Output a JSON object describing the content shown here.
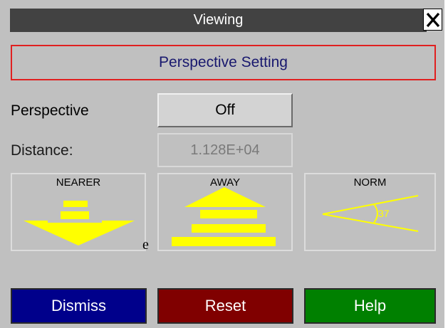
{
  "window": {
    "title": "Viewing",
    "close_glyph": "X"
  },
  "section": {
    "title": "Perspective Setting"
  },
  "perspective": {
    "label": "Perspective",
    "button": "Off"
  },
  "distance": {
    "label": "Distance:",
    "value": "1.128E+04"
  },
  "icons": [
    {
      "label": "NEARER",
      "icon": "arrow-down-icon"
    },
    {
      "label": "AWAY",
      "icon": "arrow-up-icon"
    },
    {
      "label": "NORM",
      "icon": "view-angle-icon",
      "angle_text": "37"
    }
  ],
  "footer": {
    "dismiss": "Dismiss",
    "reset": "Reset",
    "help": "Help"
  },
  "stray_text": "e",
  "colors": {
    "title_bar": "#424242",
    "panel": "#c0c0c0",
    "section_border": "#e02020",
    "section_text": "#18186e",
    "arrow_yellow": "#ffff00",
    "dismiss": "#00008b",
    "reset": "#800000",
    "help": "#008000"
  }
}
